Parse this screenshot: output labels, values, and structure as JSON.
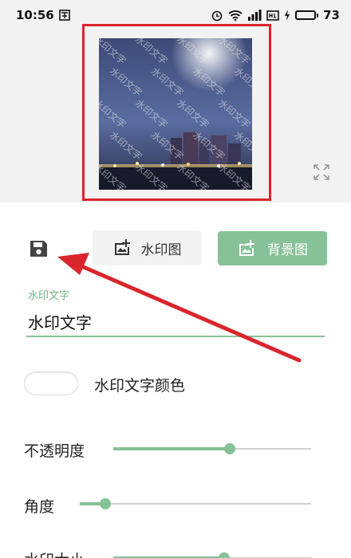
{
  "status_bar": {
    "time": "10:56",
    "battery": "73",
    "battery_level": 0.73
  },
  "preview": {
    "watermark_text": "水印文字"
  },
  "toolbar": {
    "save_icon": "save-icon",
    "watermark_image_label": "水印图",
    "background_label": "背景图"
  },
  "text_field": {
    "label": "水印文字",
    "value": "水印文字"
  },
  "color_option": {
    "label": "水印文字颜色"
  },
  "sliders": [
    {
      "label": "不透明度",
      "value": 0.59
    },
    {
      "label": "角度",
      "value": 0.11
    },
    {
      "label": "水印大小",
      "value": 0.56
    }
  ],
  "colors": {
    "accent": "#86c197",
    "annotation": "#d9252c"
  }
}
